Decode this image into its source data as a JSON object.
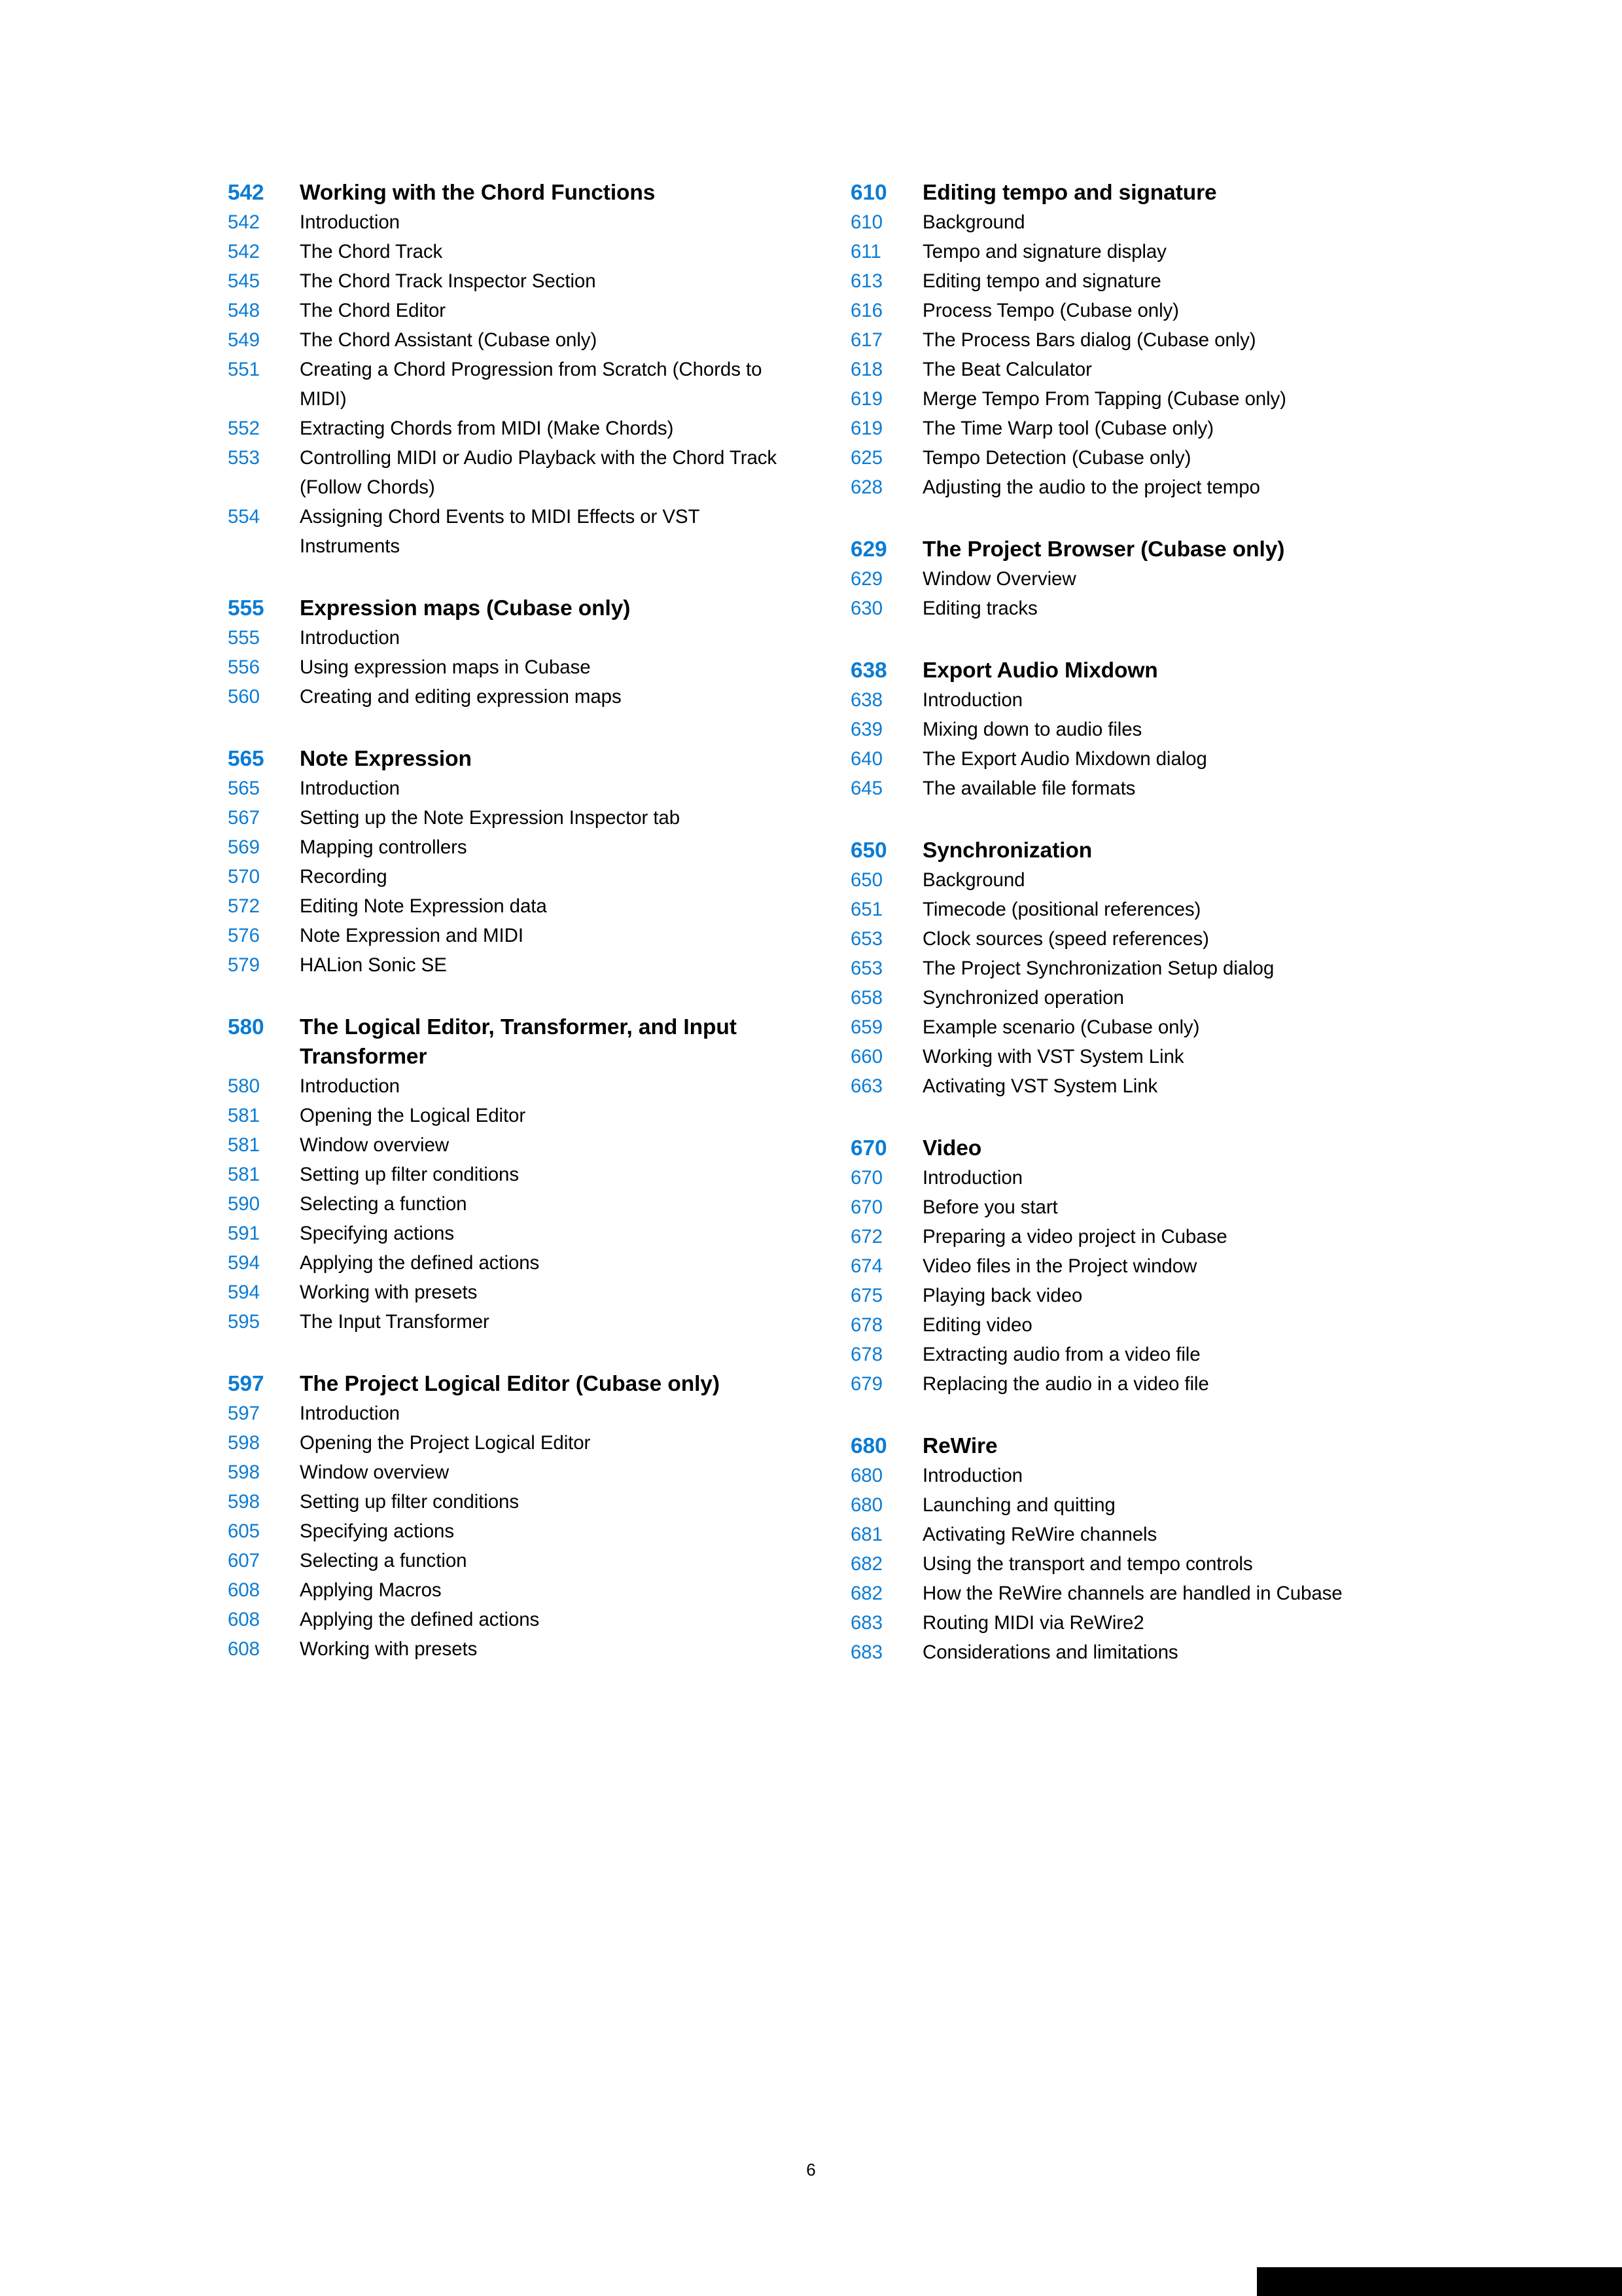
{
  "page": {
    "folio": "6",
    "accent_color": "#0b7cd4",
    "text_color": "#000000",
    "background_color": "#ffffff",
    "corner_bar_color": "#000000"
  },
  "columns": [
    {
      "name": "left-column",
      "entries": [
        {
          "page": "542",
          "title": "Working with the Chord Functions",
          "level": "chapter"
        },
        {
          "page": "542",
          "title": "Introduction",
          "level": "sub"
        },
        {
          "page": "542",
          "title": "The Chord Track",
          "level": "sub"
        },
        {
          "page": "545",
          "title": "The Chord Track Inspector Section",
          "level": "sub"
        },
        {
          "page": "548",
          "title": "The Chord Editor",
          "level": "sub"
        },
        {
          "page": "549",
          "title": "The Chord Assistant (Cubase only)",
          "level": "sub"
        },
        {
          "page": "551",
          "title": "Creating a Chord Progression from Scratch (Chords to MIDI)",
          "level": "sub"
        },
        {
          "page": "552",
          "title": "Extracting Chords from MIDI (Make Chords)",
          "level": "sub"
        },
        {
          "page": "553",
          "title": "Controlling MIDI or Audio Playback with the Chord Track (Follow Chords)",
          "level": "sub"
        },
        {
          "page": "554",
          "title": "Assigning Chord Events to MIDI Effects or VST Instruments",
          "level": "sub"
        },
        {
          "page": "555",
          "title": "Expression maps (Cubase only)",
          "level": "chapter"
        },
        {
          "page": "555",
          "title": "Introduction",
          "level": "sub"
        },
        {
          "page": "556",
          "title": "Using expression maps in Cubase",
          "level": "sub"
        },
        {
          "page": "560",
          "title": "Creating and editing expression maps",
          "level": "sub"
        },
        {
          "page": "565",
          "title": "Note Expression",
          "level": "chapter"
        },
        {
          "page": "565",
          "title": "Introduction",
          "level": "sub"
        },
        {
          "page": "567",
          "title": "Setting up the Note Expression Inspector tab",
          "level": "sub"
        },
        {
          "page": "569",
          "title": "Mapping controllers",
          "level": "sub"
        },
        {
          "page": "570",
          "title": "Recording",
          "level": "sub"
        },
        {
          "page": "572",
          "title": "Editing Note Expression data",
          "level": "sub"
        },
        {
          "page": "576",
          "title": "Note Expression and MIDI",
          "level": "sub"
        },
        {
          "page": "579",
          "title": "HALion Sonic SE",
          "level": "sub"
        },
        {
          "page": "580",
          "title": "The Logical Editor, Transformer, and Input Transformer",
          "level": "chapter"
        },
        {
          "page": "580",
          "title": "Introduction",
          "level": "sub"
        },
        {
          "page": "581",
          "title": "Opening the Logical Editor",
          "level": "sub"
        },
        {
          "page": "581",
          "title": "Window overview",
          "level": "sub"
        },
        {
          "page": "581",
          "title": "Setting up filter conditions",
          "level": "sub"
        },
        {
          "page": "590",
          "title": "Selecting a function",
          "level": "sub"
        },
        {
          "page": "591",
          "title": "Specifying actions",
          "level": "sub"
        },
        {
          "page": "594",
          "title": "Applying the defined actions",
          "level": "sub"
        },
        {
          "page": "594",
          "title": "Working with presets",
          "level": "sub"
        },
        {
          "page": "595",
          "title": "The Input Transformer",
          "level": "sub"
        },
        {
          "page": "597",
          "title": "The Project Logical Editor (Cubase only)",
          "level": "chapter"
        },
        {
          "page": "597",
          "title": "Introduction",
          "level": "sub"
        },
        {
          "page": "598",
          "title": "Opening the Project Logical Editor",
          "level": "sub"
        },
        {
          "page": "598",
          "title": "Window overview",
          "level": "sub"
        },
        {
          "page": "598",
          "title": "Setting up filter conditions",
          "level": "sub"
        },
        {
          "page": "605",
          "title": "Specifying actions",
          "level": "sub"
        },
        {
          "page": "607",
          "title": "Selecting a function",
          "level": "sub"
        },
        {
          "page": "608",
          "title": "Applying Macros",
          "level": "sub"
        },
        {
          "page": "608",
          "title": "Applying the defined actions",
          "level": "sub"
        },
        {
          "page": "608",
          "title": "Working with presets",
          "level": "sub"
        }
      ]
    },
    {
      "name": "right-column",
      "entries": [
        {
          "page": "610",
          "title": "Editing tempo and signature",
          "level": "chapter"
        },
        {
          "page": "610",
          "title": "Background",
          "level": "sub"
        },
        {
          "page": "611",
          "title": "Tempo and signature display",
          "level": "sub"
        },
        {
          "page": "613",
          "title": "Editing tempo and signature",
          "level": "sub"
        },
        {
          "page": "616",
          "title": "Process Tempo (Cubase only)",
          "level": "sub"
        },
        {
          "page": "617",
          "title": "The Process Bars dialog (Cubase only)",
          "level": "sub"
        },
        {
          "page": "618",
          "title": "The Beat Calculator",
          "level": "sub"
        },
        {
          "page": "619",
          "title": "Merge Tempo From Tapping (Cubase only)",
          "level": "sub"
        },
        {
          "page": "619",
          "title": "The Time Warp tool (Cubase only)",
          "level": "sub"
        },
        {
          "page": "625",
          "title": "Tempo Detection (Cubase only)",
          "level": "sub"
        },
        {
          "page": "628",
          "title": "Adjusting the audio to the project tempo",
          "level": "sub"
        },
        {
          "page": "629",
          "title": "The Project Browser (Cubase only)",
          "level": "chapter"
        },
        {
          "page": "629",
          "title": "Window Overview",
          "level": "sub"
        },
        {
          "page": "630",
          "title": "Editing tracks",
          "level": "sub"
        },
        {
          "page": "638",
          "title": "Export Audio Mixdown",
          "level": "chapter"
        },
        {
          "page": "638",
          "title": "Introduction",
          "level": "sub"
        },
        {
          "page": "639",
          "title": "Mixing down to audio files",
          "level": "sub"
        },
        {
          "page": "640",
          "title": "The Export Audio Mixdown dialog",
          "level": "sub"
        },
        {
          "page": "645",
          "title": "The available file formats",
          "level": "sub"
        },
        {
          "page": "650",
          "title": "Synchronization",
          "level": "chapter"
        },
        {
          "page": "650",
          "title": "Background",
          "level": "sub"
        },
        {
          "page": "651",
          "title": "Timecode (positional references)",
          "level": "sub"
        },
        {
          "page": "653",
          "title": "Clock sources (speed references)",
          "level": "sub"
        },
        {
          "page": "653",
          "title": "The Project Synchronization Setup dialog",
          "level": "sub"
        },
        {
          "page": "658",
          "title": "Synchronized operation",
          "level": "sub"
        },
        {
          "page": "659",
          "title": "Example scenario (Cubase only)",
          "level": "sub"
        },
        {
          "page": "660",
          "title": "Working with VST System Link",
          "level": "sub"
        },
        {
          "page": "663",
          "title": "Activating VST System Link",
          "level": "sub"
        },
        {
          "page": "670",
          "title": "Video",
          "level": "chapter"
        },
        {
          "page": "670",
          "title": "Introduction",
          "level": "sub"
        },
        {
          "page": "670",
          "title": "Before you start",
          "level": "sub"
        },
        {
          "page": "672",
          "title": "Preparing a video project in Cubase",
          "level": "sub"
        },
        {
          "page": "674",
          "title": "Video files in the Project window",
          "level": "sub"
        },
        {
          "page": "675",
          "title": "Playing back video",
          "level": "sub"
        },
        {
          "page": "678",
          "title": "Editing video",
          "level": "sub"
        },
        {
          "page": "678",
          "title": "Extracting audio from a video file",
          "level": "sub"
        },
        {
          "page": "679",
          "title": "Replacing the audio in a video file",
          "level": "sub"
        },
        {
          "page": "680",
          "title": "ReWire",
          "level": "chapter"
        },
        {
          "page": "680",
          "title": "Introduction",
          "level": "sub"
        },
        {
          "page": "680",
          "title": "Launching and quitting",
          "level": "sub"
        },
        {
          "page": "681",
          "title": "Activating ReWire channels",
          "level": "sub"
        },
        {
          "page": "682",
          "title": "Using the transport and tempo controls",
          "level": "sub"
        },
        {
          "page": "682",
          "title": "How the ReWire channels are handled in Cubase",
          "level": "sub"
        },
        {
          "page": "683",
          "title": "Routing MIDI via ReWire2",
          "level": "sub"
        },
        {
          "page": "683",
          "title": "Considerations and limitations",
          "level": "sub"
        }
      ]
    }
  ]
}
